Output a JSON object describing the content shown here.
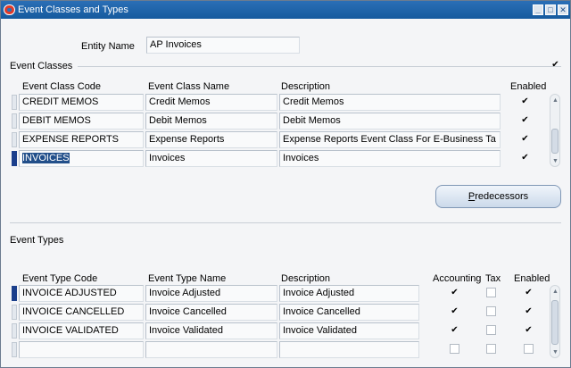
{
  "window": {
    "title": "Event Classes and Types"
  },
  "entity": {
    "label": "Entity Name",
    "value": "AP Invoices"
  },
  "event_classes": {
    "section_label": "Event Classes",
    "headers": {
      "code": "Event Class Code",
      "name": "Event Class Name",
      "description": "Description",
      "enabled": "Enabled"
    },
    "rows": [
      {
        "code": "CREDIT MEMOS",
        "name": "Credit Memos",
        "description": "Credit Memos",
        "enabled": true
      },
      {
        "code": "DEBIT MEMOS",
        "name": "Debit Memos",
        "description": "Debit Memos",
        "enabled": true
      },
      {
        "code": "EXPENSE REPORTS",
        "name": "Expense Reports",
        "description": "Expense Reports Event Class For E-Business Ta",
        "enabled": true
      },
      {
        "code": "INVOICES",
        "name": "Invoices",
        "description": "Invoices",
        "enabled": true
      }
    ],
    "predecessors_button": {
      "accel": "P",
      "rest": "redecessors"
    }
  },
  "event_types": {
    "section_label": "Event Types",
    "headers": {
      "code": "Event Type Code",
      "name": "Event Type Name",
      "description": "Description",
      "accounting": "Accounting",
      "tax": "Tax",
      "enabled": "Enabled"
    },
    "rows": [
      {
        "code": "INVOICE ADJUSTED",
        "name": "Invoice Adjusted",
        "description": "Invoice Adjusted",
        "accounting": true,
        "tax": false,
        "enabled": true
      },
      {
        "code": "INVOICE CANCELLED",
        "name": "Invoice Cancelled",
        "description": "Invoice Cancelled",
        "accounting": true,
        "tax": false,
        "enabled": true
      },
      {
        "code": "INVOICE VALIDATED",
        "name": "Invoice Validated",
        "description": "Invoice Validated",
        "accounting": true,
        "tax": false,
        "enabled": true
      },
      {
        "code": "",
        "name": "",
        "description": "",
        "accounting": false,
        "tax": false,
        "enabled": false
      }
    ]
  },
  "check_glyph": "✔"
}
